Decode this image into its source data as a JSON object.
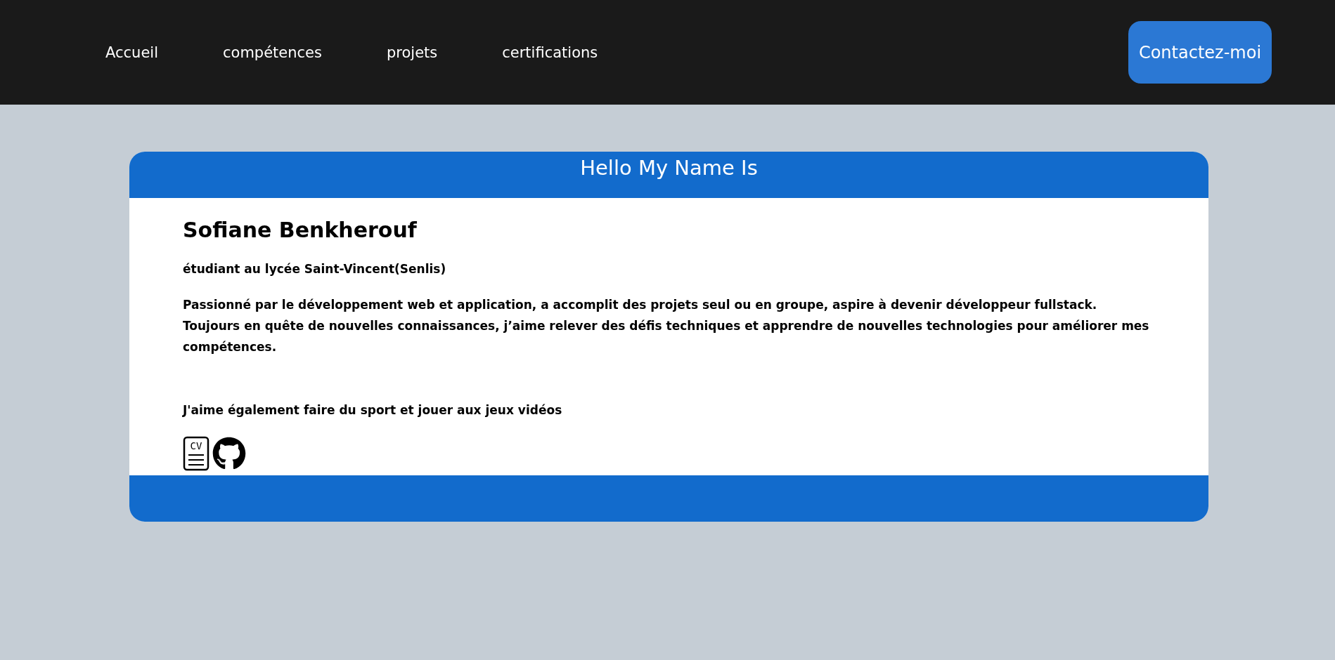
{
  "nav": {
    "links": [
      {
        "label": "Accueil"
      },
      {
        "label": "compétences"
      },
      {
        "label": "projets"
      },
      {
        "label": "certifications"
      }
    ],
    "contact_button": "Contactez-moi"
  },
  "card": {
    "title": "Hello My Name Is",
    "name": "Sofiane Benkherouf",
    "subtitle": "étudiant au lycée Saint-Vincent(Senlis)",
    "paragraphs": [
      "Passionné par le développement web et application, a accomplit des projets seul ou en groupe, aspire à devenir développeur fullstack. Toujours en quête de nouvelles connaissances, j’aime relever des défis techniques et apprendre de nouvelles technologies pour améliorer mes compétences.",
      "J'aime également faire du sport et jouer aux jeux vidéos"
    ],
    "links": [
      {
        "kind": "cv",
        "text": "CV"
      },
      {
        "kind": "github"
      }
    ]
  }
}
